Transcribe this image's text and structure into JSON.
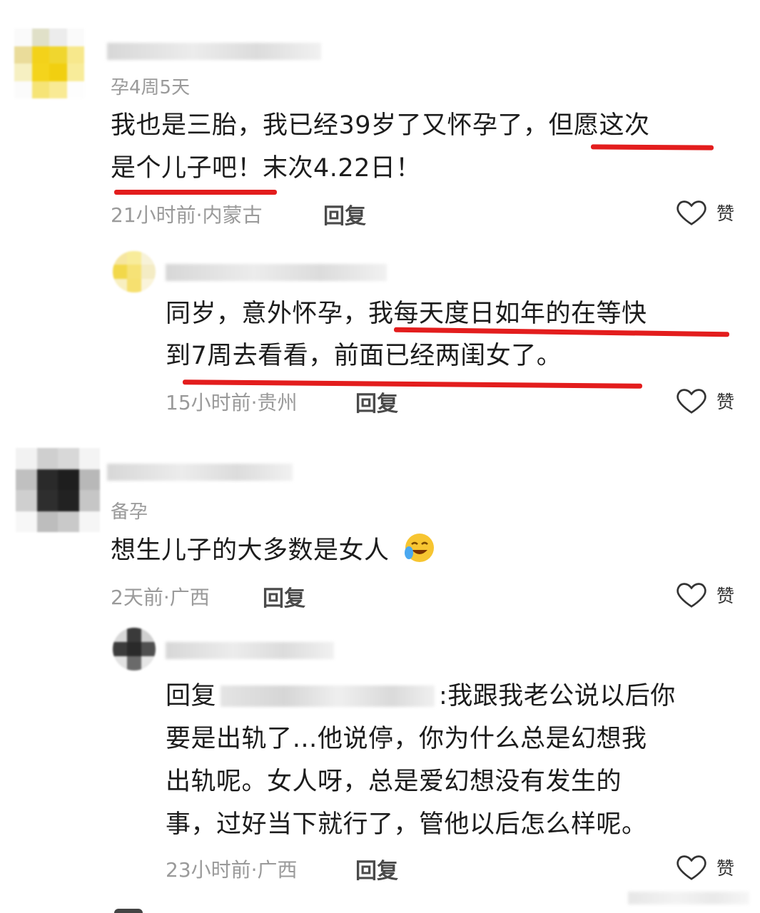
{
  "comments": [
    {
      "tag": "孕4周5天",
      "text_line1": "我也是三胎，我已经39岁了又怀孕了，但愿这次",
      "text_line2": "是个儿子吧！末次4.22日！",
      "meta": "21小时前·内蒙古",
      "reply_label": "回复",
      "like_label": "赞",
      "avatar_color": "#f2d21a"
    },
    {
      "text_line1": "同岁，意外怀孕，我每天度日如年的在等快",
      "text_line2": "到7周去看看，前面已经两闺女了。",
      "meta": "15小时前·贵州",
      "reply_label": "回复",
      "like_label": "赞",
      "avatar_color": "#f5df80"
    },
    {
      "tag": "备孕",
      "text": "想生儿子的大多数是女人",
      "emoji": "crying-laughing-emoji",
      "meta": "2天前·广西",
      "reply_label": "回复",
      "like_label": "赞",
      "avatar_color": "#222222"
    },
    {
      "reply_prefix": "回复",
      "reply_suffix": ":我跟我老公说以后你",
      "text_line2": "要是出轨了…他说停，你为什么总是幻想我",
      "text_line3": "出轨呢。女人呀，总是爱幻想没有发生的",
      "text_line4": "事，过好当下就行了，管他以后怎么样呢。",
      "meta": "23小时前·广西",
      "reply_label": "回复",
      "like_label": "赞",
      "avatar_color": "#333333"
    }
  ],
  "colors": {
    "highlight_underline": "#e31d1d",
    "meta_text": "#9a9a9a"
  }
}
